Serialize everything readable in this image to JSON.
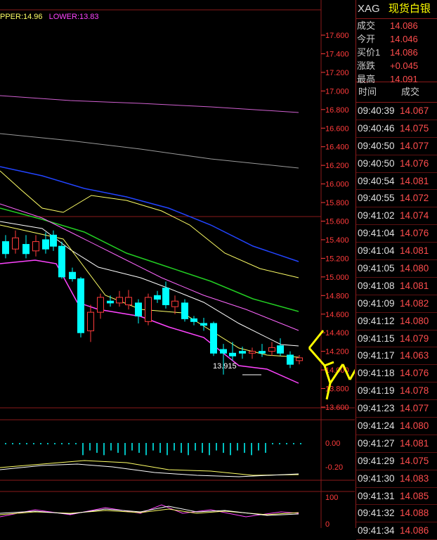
{
  "symbol": "XAG",
  "instrument_name": "现货白银",
  "legend": {
    "upper": "PPER:14.96",
    "lower": "LOWER:13.83"
  },
  "quotes": [
    {
      "label": "成交",
      "value": "14.086"
    },
    {
      "label": "今开",
      "value": "14.046"
    },
    {
      "label": "买价1",
      "value": "14.086"
    },
    {
      "label": "涨跌",
      "value": "+0.045"
    },
    {
      "label": "最高",
      "value": "14.091"
    }
  ],
  "ticks_header": {
    "time": "时间",
    "price": "成交"
  },
  "ticks": [
    {
      "time": "09:40:39",
      "price": "14.067"
    },
    {
      "time": "09:40:46",
      "price": "14.075"
    },
    {
      "time": "09:40:50",
      "price": "14.077"
    },
    {
      "time": "09:40:50",
      "price": "14.076"
    },
    {
      "time": "09:40:54",
      "price": "14.081"
    },
    {
      "time": "09:40:55",
      "price": "14.072"
    },
    {
      "time": "09:41:02",
      "price": "14.074"
    },
    {
      "time": "09:41:04",
      "price": "14.076"
    },
    {
      "time": "09:41:04",
      "price": "14.081"
    },
    {
      "time": "09:41:05",
      "price": "14.080"
    },
    {
      "time": "09:41:08",
      "price": "14.081"
    },
    {
      "time": "09:41:09",
      "price": "14.082"
    },
    {
      "time": "09:41:12",
      "price": "14.080"
    },
    {
      "time": "09:41:15",
      "price": "14.079"
    },
    {
      "time": "09:41:17",
      "price": "14.063"
    },
    {
      "time": "09:41:18",
      "price": "14.076"
    },
    {
      "time": "09:41:19",
      "price": "14.078"
    },
    {
      "time": "09:41:23",
      "price": "14.077"
    },
    {
      "time": "09:41:24",
      "price": "14.080"
    },
    {
      "time": "09:41:27",
      "price": "14.081"
    },
    {
      "time": "09:41:29",
      "price": "14.075"
    },
    {
      "time": "09:41:30",
      "price": "14.083"
    },
    {
      "time": "09:41:31",
      "price": "14.085"
    },
    {
      "time": "09:41:32",
      "price": "14.088"
    },
    {
      "time": "09:41:34",
      "price": "14.086"
    }
  ],
  "price_axis": [
    "17.600",
    "17.400",
    "17.200",
    "17.000",
    "16.800",
    "16.600",
    "16.400",
    "16.200",
    "16.000",
    "15.800",
    "15.600",
    "15.400",
    "15.200",
    "15.000",
    "14.800",
    "14.600",
    "14.400",
    "14.200",
    "14.000",
    "13.800",
    "13.600"
  ],
  "low_marker": "13.915",
  "macd_axis": [
    "0.00",
    "-0.20"
  ],
  "kdj_axis": [
    "100",
    "0"
  ],
  "colors": {
    "up": "#ff3b3b",
    "down": "#00ffff",
    "grid": "#8a1a1a",
    "ma_blue": "#2244ff",
    "ma_green": "#22cc22",
    "ma_yellow": "#ffff66",
    "ma_white": "#ffffff",
    "ma_magenta": "#ff44ff",
    "arrow": "#ffff00"
  }
}
